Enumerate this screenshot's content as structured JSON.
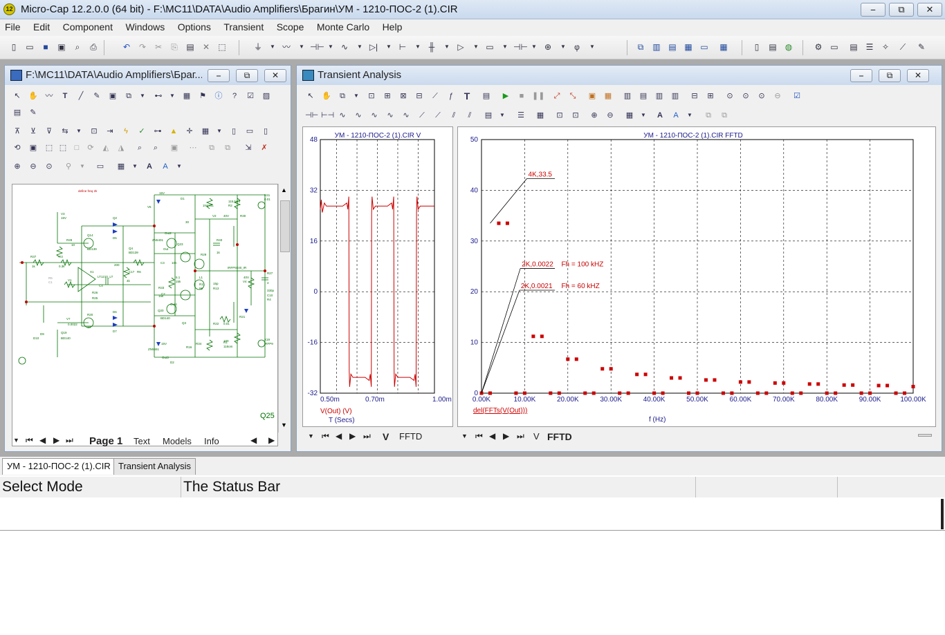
{
  "app": {
    "icon_label": "12",
    "title": "Micro-Cap 12.2.0.0 (64 bit) - F:\\MC11\\DATA\\Audio Amplifiers\\Брагин\\УМ - 1210-ПОС-2  (1).CIR",
    "minimize": "⎯",
    "restore": "⧉",
    "close": "✕"
  },
  "menu": [
    "File",
    "Edit",
    "Component",
    "Windows",
    "Options",
    "Transient",
    "Scope",
    "Monte Carlo",
    "Help"
  ],
  "schematic_window": {
    "title": "F:\\MC11\\DATA\\Audio Amplifiers\\Браг...",
    "tabs": [
      "Page 1",
      "Text",
      "Models",
      "Info"
    ],
    "note": "define freq 2k",
    "labels": [
      "V3",
      "15V",
      "R28",
      "10",
      "Q14",
      "BD139",
      "R37",
      "1k",
      "R3",
      "0.3k",
      "V1",
      "R5",
      "C1",
      "10u",
      "X1",
      "LT1210_LT",
      "C17",
      "R6",
      "200",
      "R26",
      "R25",
      "4k",
      "R36",
      "Q2",
      "D5",
      "D6",
      "D7",
      "D9",
      "D10",
      "V7",
      "0.0022",
      "R20",
      "10",
      "Q19",
      "BD140",
      "V6",
      "15V",
      "D1",
      "1N4731",
      "115.5om",
      "R2",
      "R31",
      "0.01",
      "V2",
      "40V",
      "R30",
      "30",
      "IRFP9240_IR",
      "Out2",
      "Out",
      "ZN5401",
      "Q23",
      "Q4",
      "BD139",
      "C3",
      "10n",
      "R33",
      "R29",
      "R40",
      "1k",
      "C4",
      "C2",
      "15p",
      "R13",
      "R11",
      "55",
      "Q20",
      "BD140",
      "Q3",
      "ZN5551",
      "Out3",
      "D2",
      "R16",
      "R34",
      "R1",
      "118om",
      "R22",
      "0.01",
      "R21",
      "100",
      "X19",
      "IRFP9",
      "V4",
      "40V",
      "R27",
      "4",
      "C10",
      "330p",
      "R4",
      "5.1",
      "L1",
      "15k",
      "Out4",
      "15k",
      "Q25",
      "R18",
      "V65"
    ]
  },
  "transient_window": {
    "title": "Transient Analysis",
    "left_tabs": [
      "V",
      "FFTD"
    ],
    "right_tabs": [
      "V",
      "FFTD"
    ],
    "left_plot_title": "УМ - 1210-ПОС-2  (1).CIR V",
    "right_plot_title": "УМ - 1210-ПОС-2  (1).CIR FFTD",
    "left_expr": "V(Out) (V)",
    "left_xlabel": "T (Secs)",
    "right_expr": "del(FFTs(V(Out)))",
    "right_xlabel": "f (Hz)",
    "annotations": [
      {
        "text": "4K,33.5"
      },
      {
        "text": "2K,0.0022",
        "note": "Fh = 100 kHZ"
      },
      {
        "text": "2K,0.0021",
        "note": "Fh = 60 kHZ"
      }
    ]
  },
  "chart_data": [
    {
      "type": "line",
      "title": "УМ - 1210-ПОС-2  (1).CIR V",
      "xlabel": "T (Secs)",
      "ylabel": "V(Out) (V)",
      "xlim": [
        0.00047,
        0.00103
      ],
      "ylim": [
        -32,
        48
      ],
      "yticks": [
        48,
        32,
        16,
        0,
        -16,
        -32
      ],
      "xtick_labels": [
        "0.50m",
        "0.70m",
        "1.00m"
      ],
      "series": [
        {
          "x": [
            0.00047,
            0.000475,
            0.00048,
            0.00049,
            0.0005,
            0.00052,
            0.00054,
            0.00056,
            0.00058,
            0.0006,
            0.000605,
            0.00061,
            0.000612,
            0.000614,
            0.00062,
            0.00063,
            0.00065,
            0.00067,
            0.00069,
            0.00071,
            0.000715,
            0.00072,
            0.000722,
            0.000724,
            0.00073,
            0.00074,
            0.00076,
            0.00078,
            0.0008,
            0.00082,
            0.000825,
            0.00083,
            0.000832,
            0.000834,
            0.00084,
            0.00085,
            0.00087,
            0.00089,
            0.00091,
            0.00093,
            0.000935,
            0.00094,
            0.000942,
            0.000944,
            0.00095,
            0.00096,
            0.00098,
            0.001,
            0.00102,
            0.00103
          ],
          "y": [
            26,
            29,
            25,
            28,
            27,
            27,
            27,
            27,
            27,
            28,
            26,
            30,
            -25,
            -30,
            -26,
            -27,
            -27,
            -27,
            -27,
            -28,
            -26,
            -30,
            25,
            30,
            26,
            27,
            27,
            27,
            27,
            28,
            26,
            30,
            -25,
            -30,
            -26,
            -27,
            -27,
            -27,
            -27,
            -28,
            -26,
            -30,
            25,
            30,
            26,
            27,
            27,
            27,
            27,
            27
          ]
        }
      ]
    },
    {
      "type": "scatter",
      "title": "УМ - 1210-ПОС-2  (1).CIR FFTD",
      "xlabel": "f (Hz)",
      "ylabel": "del(FFTs(V(Out)))",
      "xlim": [
        0,
        100000
      ],
      "ylim": [
        0,
        50
      ],
      "yticks": [
        0,
        10,
        20,
        30,
        40,
        50
      ],
      "xtick_labels": [
        "0.00K",
        "10.00K",
        "20.00K",
        "30.00K",
        "40.00K",
        "50.00K",
        "60.00K",
        "70.00K",
        "80.00K",
        "90.00K",
        "100.00K"
      ],
      "series": [
        {
          "x": [
            0,
            2000,
            4000,
            6000,
            8000,
            10000,
            12000,
            14000,
            16000,
            18000,
            20000,
            22000,
            24000,
            26000,
            28000,
            30000,
            32000,
            34000,
            36000,
            38000,
            40000,
            42000,
            44000,
            46000,
            48000,
            50000,
            52000,
            54000,
            56000,
            58000,
            60000,
            62000,
            64000,
            66000,
            68000,
            70000,
            72000,
            74000,
            76000,
            78000,
            80000,
            82000,
            84000,
            86000,
            88000,
            90000,
            92000,
            94000,
            96000,
            98000,
            100000
          ],
          "y": [
            0,
            0,
            33.5,
            33.5,
            0,
            0,
            11.2,
            11.2,
            0,
            0,
            6.7,
            6.7,
            0,
            0,
            4.8,
            4.8,
            0,
            0,
            3.7,
            3.7,
            0,
            0,
            3.0,
            3.0,
            0,
            0,
            2.6,
            2.6,
            0,
            0,
            2.2,
            2.2,
            0,
            0,
            2.0,
            2.0,
            0,
            0,
            1.8,
            1.8,
            0,
            0,
            1.6,
            1.6,
            0,
            0,
            1.5,
            1.5,
            0,
            0,
            1.3
          ]
        }
      ]
    }
  ],
  "doc_tabs": [
    "УМ - 1210-ПОС-2  (1).CIR",
    "Transient Analysis"
  ],
  "status": {
    "mode": "Select Mode",
    "bar": "The Status Bar"
  },
  "colors": {
    "trace": "#cc0000",
    "grid": "#000000",
    "axis_text": "#1a1a8c",
    "schematic": "#007000"
  }
}
